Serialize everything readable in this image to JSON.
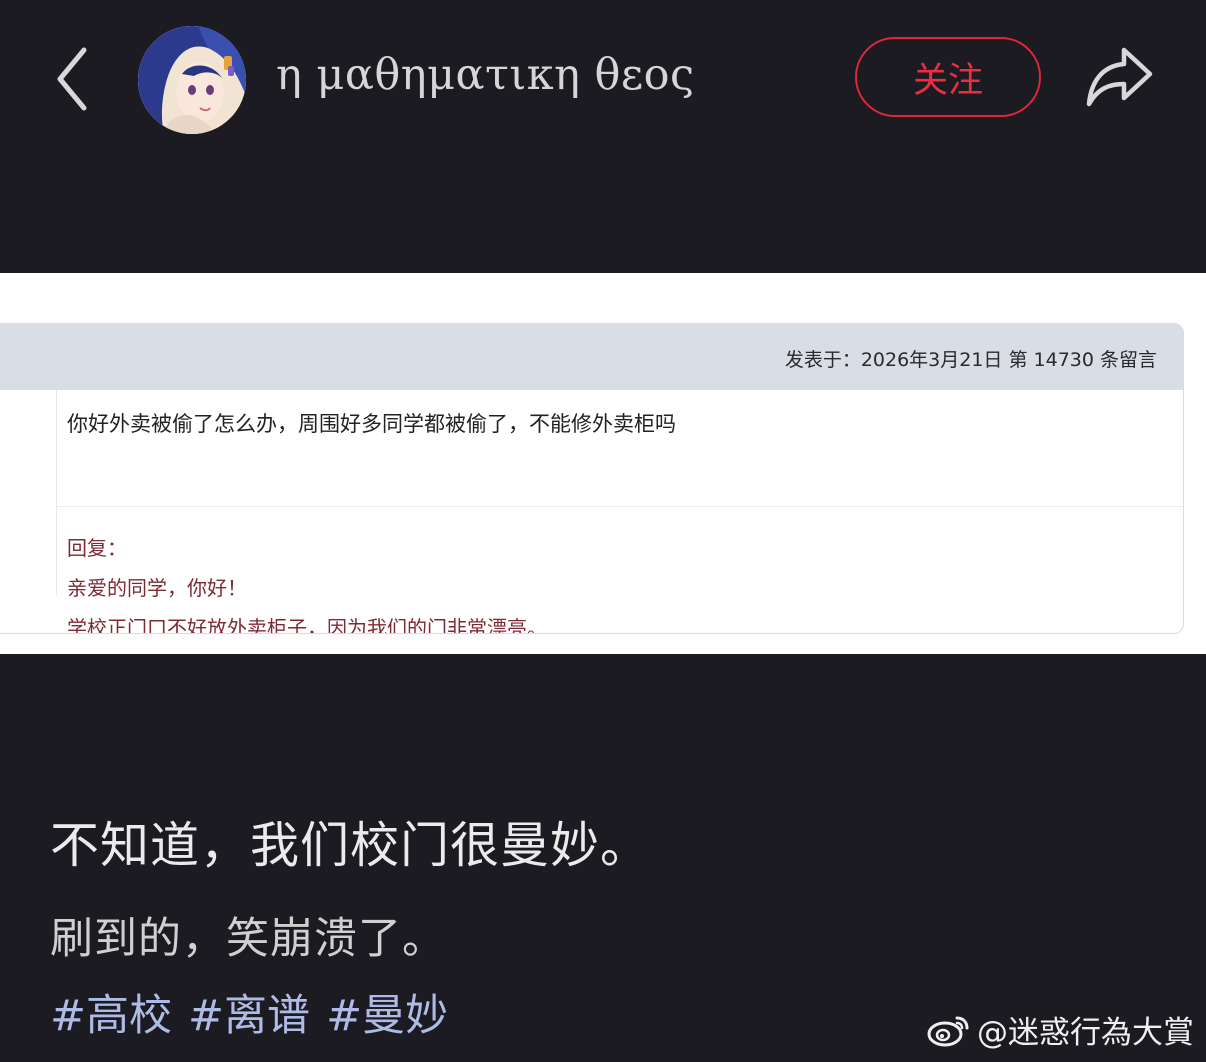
{
  "header": {
    "username": "η μαθηματικη θεος",
    "follow_label": "关注"
  },
  "screenshot": {
    "meta": "发表于：2026年3月21日 第 14730 条留言",
    "question": "你好外卖被偷了怎么办，周围好多同学都被偷了，不能修外卖柜吗",
    "reply_label": "回复：",
    "reply_line1": "亲爱的同学，你好！",
    "reply_line2": "学校正门口不好放外卖柜子，因为我们的门非常漂亮。"
  },
  "post": {
    "title": "不知道，我们校门很曼妙。",
    "subtitle": "刷到的，笑崩溃了。",
    "tags": [
      "#高校",
      "#离谱",
      "#曼妙"
    ]
  },
  "watermark": {
    "text": "@迷惑行為大賞"
  },
  "colors": {
    "background": "#1c1b21",
    "follow_accent": "#ec2d44",
    "tag": "#aebbe6",
    "reply_text": "#7e2a33"
  },
  "icons": {
    "back": "chevron-left-icon",
    "share": "share-arrow-icon",
    "watermark": "weibo-logo-icon"
  }
}
